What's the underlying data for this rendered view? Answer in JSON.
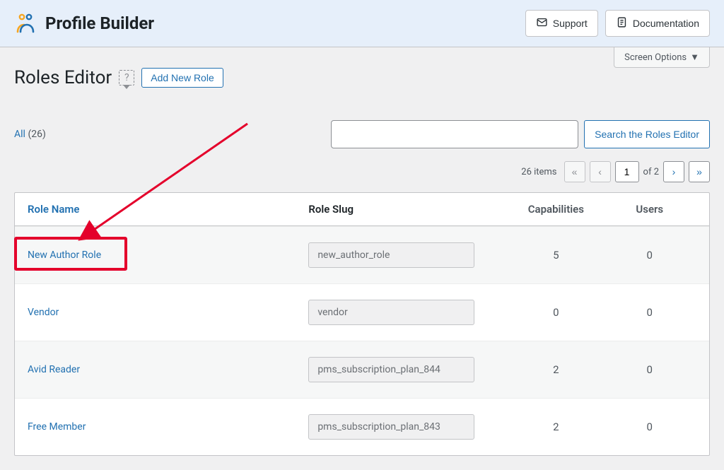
{
  "topbar": {
    "brand": "Profile Builder",
    "support_label": "Support",
    "docs_label": "Documentation"
  },
  "screen_options_label": "Screen Options",
  "heading": "Roles Editor",
  "add_new_label": "Add New Role",
  "filter": {
    "all_label": "All",
    "all_count": "(26)"
  },
  "search": {
    "value": "",
    "button_label": "Search the Roles Editor"
  },
  "pagination": {
    "items_label": "26 items",
    "current_page": "1",
    "of_label": "of 2"
  },
  "columns": {
    "name": "Role Name",
    "slug": "Role Slug",
    "capabilities": "Capabilities",
    "users": "Users"
  },
  "rows": [
    {
      "name": "New Author Role",
      "slug": "new_author_role",
      "capabilities": "5",
      "users": "0"
    },
    {
      "name": "Vendor",
      "slug": "vendor",
      "capabilities": "0",
      "users": "0"
    },
    {
      "name": "Avid Reader",
      "slug": "pms_subscription_plan_844",
      "capabilities": "2",
      "users": "0"
    },
    {
      "name": "Free Member",
      "slug": "pms_subscription_plan_843",
      "capabilities": "2",
      "users": "0"
    }
  ]
}
